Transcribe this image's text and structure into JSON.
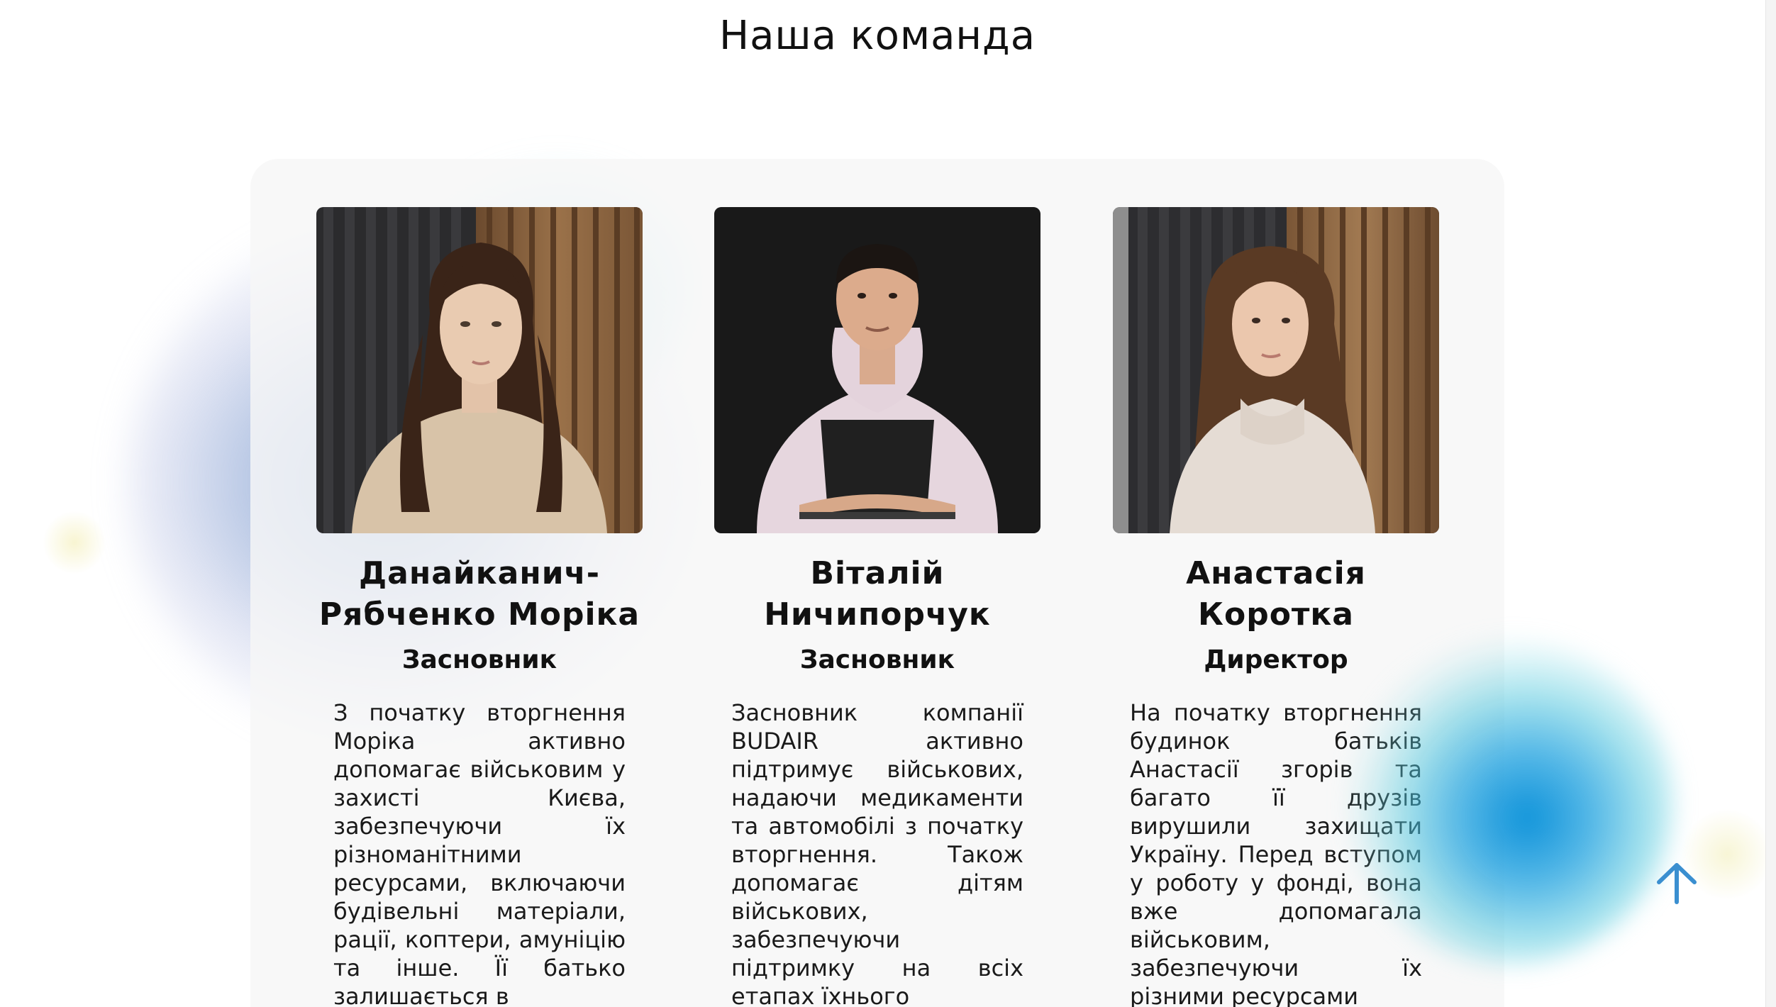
{
  "section": {
    "title": "Наша команда"
  },
  "team": [
    {
      "name_line1": "Данайканич-",
      "name_line2": "Рябченко Моріка",
      "role": "Засновник",
      "bio": "З початку вторгнення Моріка активно допомагає військовим у захисті Києва, забезпечуючи їх різноманітними ресурсами, включаючи будівельні матеріали, рації, коптери, амуніцію та інше. Її батько залишається в"
    },
    {
      "name_line1": "Віталій",
      "name_line2": "Ничипорчук",
      "role": "Засновник",
      "bio": "Засновник компанії BUDAIR активно підтримує військових, надаючи медикаменти та автомобілі з початку вторгнення. Також допомагає дітям військових, забезпечуючи підтримку на всіх етапах їхнього"
    },
    {
      "name_line1": "Анастасія",
      "name_line2": "Коротка",
      "role": "Директор",
      "bio": "На початку вторгнення будинок батьків Анастасії згорів та багато її друзів вирушили захищати Україну. Перед вступом у роботу у фонді, вона вже допомагала військовим, забезпечуючи їх різними ресурсами"
    }
  ],
  "icons": {
    "scroll_top": "arrow-up-icon"
  },
  "colors": {
    "accent": "#3a8fd0",
    "blob_blue": "#1aa0e0",
    "panel": "#f6f6f7"
  }
}
